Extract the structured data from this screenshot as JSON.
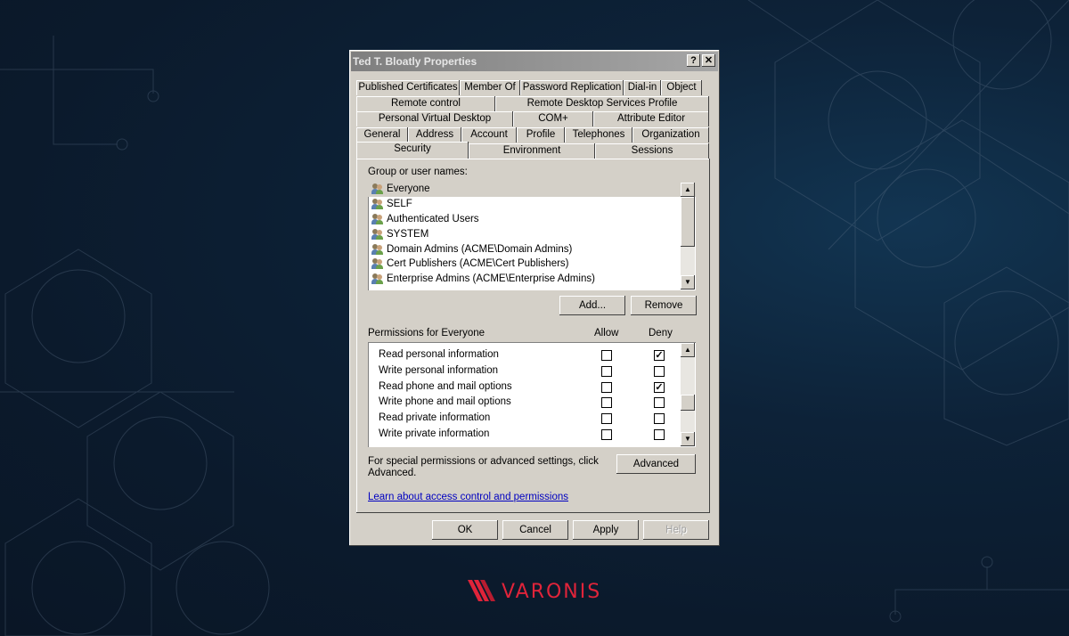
{
  "window": {
    "title": "Ted T. Bloatly Properties",
    "help_glyph": "?",
    "close_glyph": "✕"
  },
  "tabs": {
    "row1": [
      "Published Certificates",
      "Member Of",
      "Password Replication",
      "Dial-in",
      "Object"
    ],
    "row2": [
      "Remote control",
      "Remote Desktop Services Profile"
    ],
    "row3": [
      "Personal Virtual Desktop",
      "COM+",
      "Attribute Editor"
    ],
    "row4": [
      "General",
      "Address",
      "Account",
      "Profile",
      "Telephones",
      "Organization"
    ],
    "row5": [
      "Security",
      "Environment",
      "Sessions"
    ],
    "active": "Security"
  },
  "groups": {
    "label": "Group or user names:",
    "items": [
      {
        "name": "Everyone",
        "selected": true
      },
      {
        "name": "SELF",
        "selected": false
      },
      {
        "name": "Authenticated Users",
        "selected": false
      },
      {
        "name": "SYSTEM",
        "selected": false
      },
      {
        "name": "Domain Admins (ACME\\Domain Admins)",
        "selected": false
      },
      {
        "name": "Cert Publishers (ACME\\Cert Publishers)",
        "selected": false
      },
      {
        "name": "Enterprise Admins (ACME\\Enterprise Admins)",
        "selected": false
      }
    ],
    "add_label": "Add...",
    "remove_label": "Remove"
  },
  "permissions": {
    "label": "Permissions for Everyone",
    "allow_header": "Allow",
    "deny_header": "Deny",
    "rows": [
      {
        "name": "Read personal information",
        "allow": false,
        "deny": true
      },
      {
        "name": "Write personal information",
        "allow": false,
        "deny": false
      },
      {
        "name": "Read phone and mail options",
        "allow": false,
        "deny": true
      },
      {
        "name": "Write phone and mail options",
        "allow": false,
        "deny": false
      },
      {
        "name": "Read private information",
        "allow": false,
        "deny": false
      },
      {
        "name": "Write private information",
        "allow": false,
        "deny": false
      }
    ],
    "check_glyph": "✓"
  },
  "advanced": {
    "text_line1": "For special permissions or advanced settings, click",
    "text_line2": "Advanced.",
    "button_label": "Advanced"
  },
  "link_text": "Learn about access control and permissions",
  "footer": {
    "ok": "OK",
    "cancel": "Cancel",
    "apply": "Apply",
    "help": "Help"
  },
  "brand": {
    "name": "VARONIS",
    "color": "#e0243a"
  }
}
